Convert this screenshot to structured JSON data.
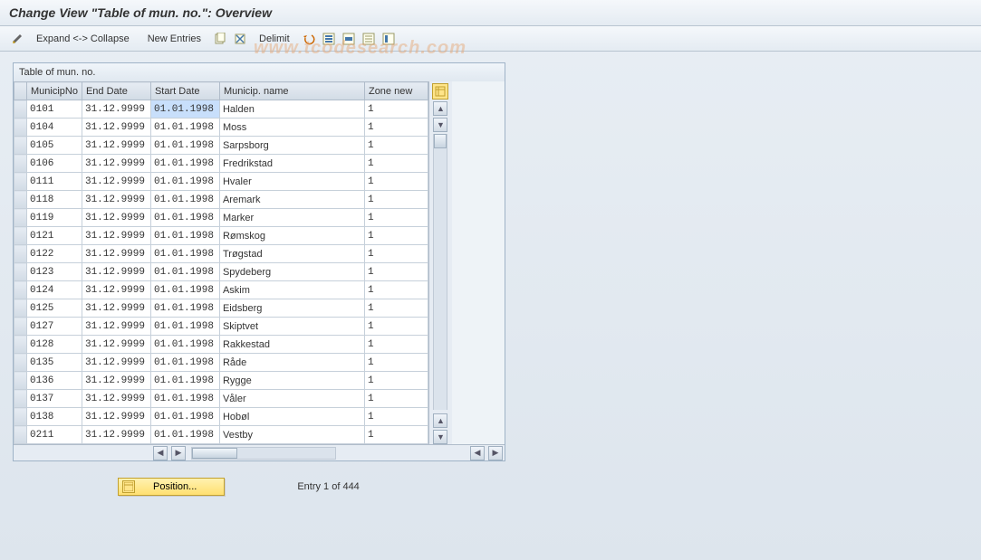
{
  "title": "Change View \"Table of mun. no.\": Overview",
  "toolbar": {
    "expand_collapse": "Expand <-> Collapse",
    "new_entries": "New Entries",
    "delimit": "Delimit"
  },
  "panel": {
    "title": "Table of mun. no."
  },
  "columns": {
    "municip_no": "MunicipNo",
    "end_date": "End Date",
    "start_date": "Start Date",
    "municip_name": "Municip. name",
    "zone_new": "Zone new"
  },
  "rows": [
    {
      "no": "0101",
      "end": "31.12.9999",
      "start": "01.01.1998",
      "name": "Halden",
      "zone": "1",
      "selected_start": true
    },
    {
      "no": "0104",
      "end": "31.12.9999",
      "start": "01.01.1998",
      "name": "Moss",
      "zone": "1"
    },
    {
      "no": "0105",
      "end": "31.12.9999",
      "start": "01.01.1998",
      "name": "Sarpsborg",
      "zone": "1"
    },
    {
      "no": "0106",
      "end": "31.12.9999",
      "start": "01.01.1998",
      "name": "Fredrikstad",
      "zone": "1"
    },
    {
      "no": "0111",
      "end": "31.12.9999",
      "start": "01.01.1998",
      "name": "Hvaler",
      "zone": "1"
    },
    {
      "no": "0118",
      "end": "31.12.9999",
      "start": "01.01.1998",
      "name": "Aremark",
      "zone": "1"
    },
    {
      "no": "0119",
      "end": "31.12.9999",
      "start": "01.01.1998",
      "name": "Marker",
      "zone": "1"
    },
    {
      "no": "0121",
      "end": "31.12.9999",
      "start": "01.01.1998",
      "name": "Rømskog",
      "zone": "1"
    },
    {
      "no": "0122",
      "end": "31.12.9999",
      "start": "01.01.1998",
      "name": "Trøgstad",
      "zone": "1"
    },
    {
      "no": "0123",
      "end": "31.12.9999",
      "start": "01.01.1998",
      "name": "Spydeberg",
      "zone": "1"
    },
    {
      "no": "0124",
      "end": "31.12.9999",
      "start": "01.01.1998",
      "name": "Askim",
      "zone": "1"
    },
    {
      "no": "0125",
      "end": "31.12.9999",
      "start": "01.01.1998",
      "name": "Eidsberg",
      "zone": "1"
    },
    {
      "no": "0127",
      "end": "31.12.9999",
      "start": "01.01.1998",
      "name": "Skiptvet",
      "zone": "1"
    },
    {
      "no": "0128",
      "end": "31.12.9999",
      "start": "01.01.1998",
      "name": "Rakkestad",
      "zone": "1"
    },
    {
      "no": "0135",
      "end": "31.12.9999",
      "start": "01.01.1998",
      "name": "Råde",
      "zone": "1"
    },
    {
      "no": "0136",
      "end": "31.12.9999",
      "start": "01.01.1998",
      "name": "Rygge",
      "zone": "1"
    },
    {
      "no": "0137",
      "end": "31.12.9999",
      "start": "01.01.1998",
      "name": "Våler",
      "zone": "1"
    },
    {
      "no": "0138",
      "end": "31.12.9999",
      "start": "01.01.1998",
      "name": "Hobøl",
      "zone": "1"
    },
    {
      "no": "0211",
      "end": "31.12.9999",
      "start": "01.01.1998",
      "name": "Vestby",
      "zone": "1"
    }
  ],
  "footer": {
    "position_label": "Position...",
    "entry_text": "Entry 1 of 444"
  }
}
